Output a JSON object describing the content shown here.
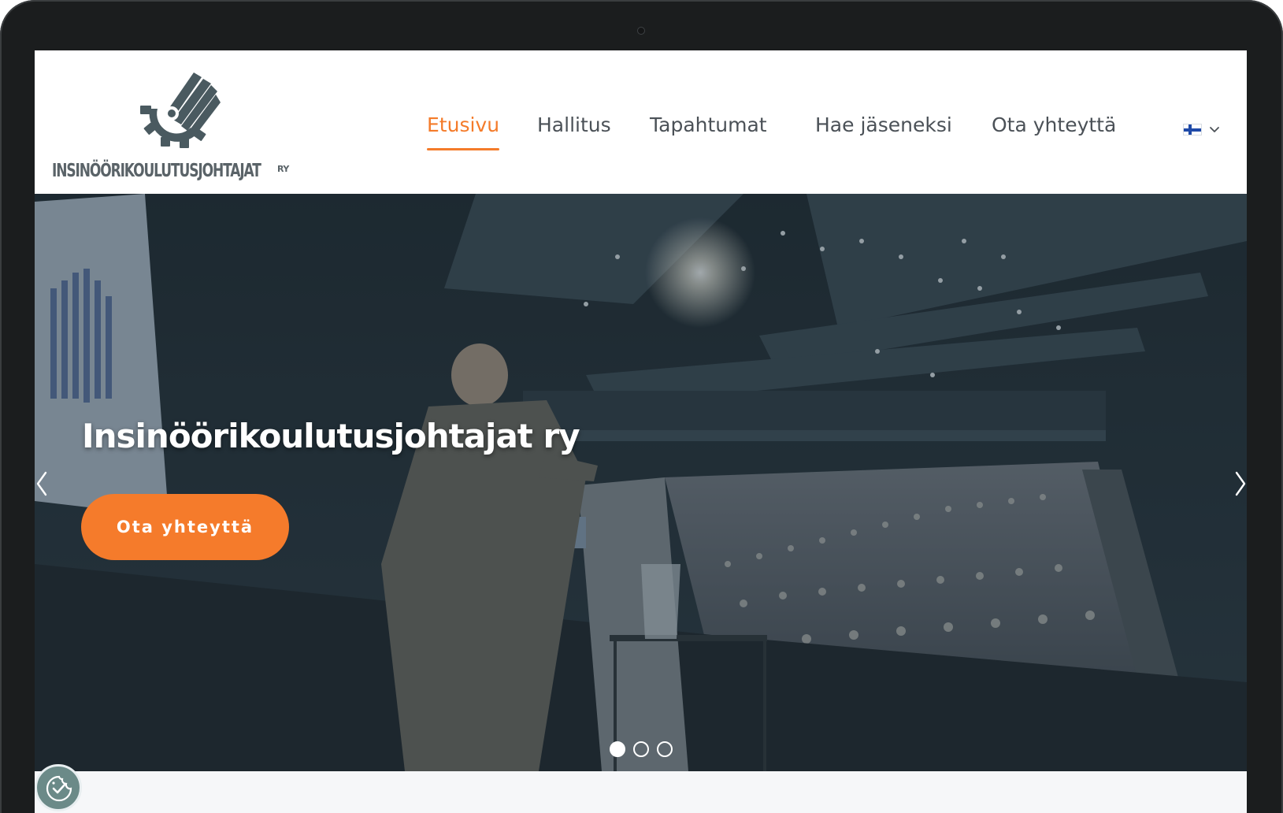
{
  "logo": {
    "text": "INSINÖÖRIKOULUTUSJOHTAJAT",
    "suffix": "RY",
    "icon": "gear-pen-icon",
    "color": "#4a5a60"
  },
  "nav": {
    "items": [
      {
        "label": "Etusivu",
        "active": true
      },
      {
        "label": "Hallitus",
        "active": false
      },
      {
        "label": "Tapahtumat",
        "active": false
      },
      {
        "label": "Hae jäseneksi",
        "active": false
      },
      {
        "label": "Ota yhteyttä",
        "active": false
      }
    ],
    "language": {
      "flag": "finland-flag-icon",
      "dropdown_icon": "chevron-down-icon"
    }
  },
  "hero": {
    "title": "Insinöörikoulutusjohtajat ry",
    "button_label": "Ota yhteyttä",
    "prev_icon": "chevron-left-icon",
    "next_icon": "chevron-right-icon",
    "slides": 3,
    "active_slide": 1,
    "image": "speaker-at-podium-in-auditorium-photo"
  },
  "cookie_badge": {
    "icon": "cookie-consent-icon"
  },
  "colors": {
    "accent": "#f47b2a",
    "nav_text": "#4b5157",
    "hero_overlay": "#1e303a",
    "badge": "#6b8a88"
  }
}
